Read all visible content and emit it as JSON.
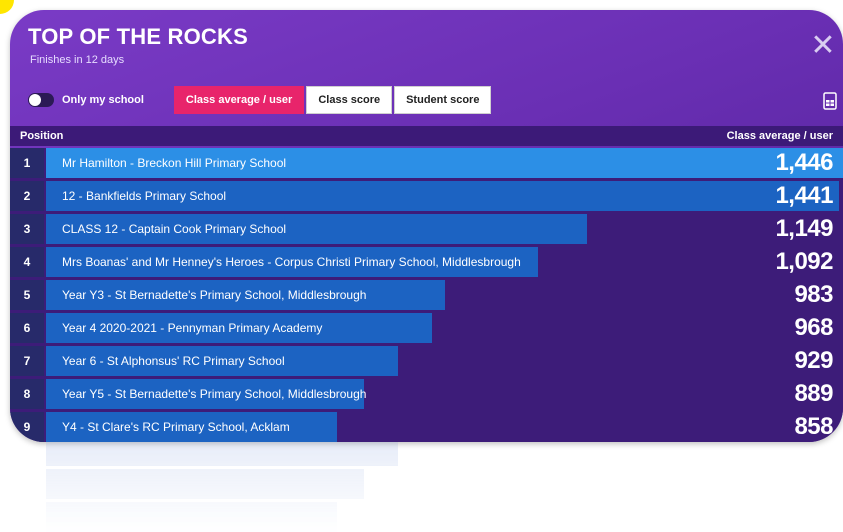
{
  "header": {
    "title": "TOP OF THE ROCKS",
    "subtitle": "Finishes in 12 days",
    "close_icon": "close-icon"
  },
  "filters": {
    "only_my_school_label": "Only my school",
    "only_my_school_on": false,
    "tabs": [
      {
        "label": "Class average / user",
        "active": true
      },
      {
        "label": "Class score",
        "active": false
      },
      {
        "label": "Student score",
        "active": false
      }
    ],
    "export_icon": "spreadsheet-export-icon"
  },
  "table": {
    "position_header": "Position",
    "metric_header": "Class average / user",
    "rows": [
      {
        "position": "1",
        "name": "Mr Hamilton - Breckon Hill Primary School",
        "score": "1,446",
        "value": 1446
      },
      {
        "position": "2",
        "name": "12 - Bankfields Primary School",
        "score": "1,441",
        "value": 1441
      },
      {
        "position": "3",
        "name": "CLASS 12 - Captain Cook Primary School",
        "score": "1,149",
        "value": 1149
      },
      {
        "position": "4",
        "name": "Mrs Boanas' and Mr Henney's Heroes - Corpus Christi Primary School, Middlesbrough",
        "score": "1,092",
        "value": 1092
      },
      {
        "position": "5",
        "name": "Year Y3 - St Bernadette's Primary School, Middlesbrough",
        "score": "983",
        "value": 983
      },
      {
        "position": "6",
        "name": "Year 4 2020-2021 - Pennyman Primary Academy",
        "score": "968",
        "value": 968
      },
      {
        "position": "7",
        "name": "Year 6 - St Alphonsus' RC Primary School",
        "score": "929",
        "value": 929
      },
      {
        "position": "8",
        "name": "Year Y5 - St Bernadette's Primary School, Middlesbrough",
        "score": "889",
        "value": 889
      },
      {
        "position": "9",
        "name": "Y4 - St Clare's RC Primary School, Acklam",
        "score": "858",
        "value": 858
      }
    ]
  },
  "colors": {
    "panel_purple": "#6a2fb4",
    "active_tab_pink": "#e8246b",
    "bar_blue": "#1c63c2",
    "top_bar_blue": "#2c8fe6",
    "corner_yellow": "#ffe600"
  }
}
